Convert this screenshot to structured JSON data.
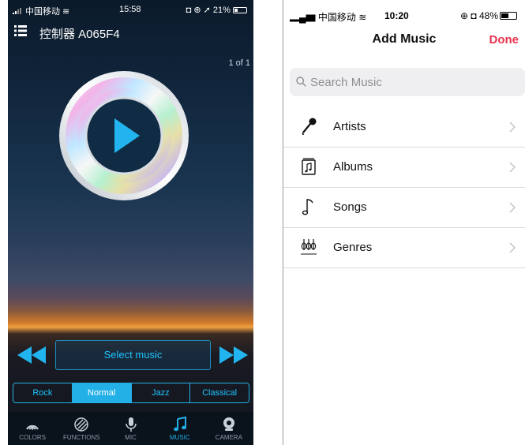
{
  "left_app": {
    "status": {
      "carrier": "中国移动",
      "time": "15:58",
      "battery": "21%"
    },
    "header": {
      "title": "控制器 A065F4"
    },
    "pager": "1 of 1",
    "select_music": "Select music",
    "genres": [
      {
        "label": "Rock",
        "active": false
      },
      {
        "label": "Normal",
        "active": true
      },
      {
        "label": "Jazz",
        "active": false
      },
      {
        "label": "Classical",
        "active": false
      }
    ],
    "tabs": [
      {
        "label": "COLORS",
        "icon": "colors-icon",
        "active": false
      },
      {
        "label": "FUNCTIONS",
        "icon": "functions-icon",
        "active": false
      },
      {
        "label": "MIC",
        "icon": "mic-icon",
        "active": false
      },
      {
        "label": "MUSIC",
        "icon": "music-note-icon",
        "active": true
      },
      {
        "label": "CAMERA",
        "icon": "camera-icon",
        "active": false
      }
    ],
    "accent_color": "#23b0e6"
  },
  "right_app": {
    "status": {
      "carrier": "中国移动",
      "time": "10:20",
      "battery": "48%"
    },
    "nav": {
      "title": "Add Music",
      "done": "Done"
    },
    "search": {
      "placeholder": "Search Music"
    },
    "items": [
      {
        "label": "Artists",
        "icon": "microphone-icon"
      },
      {
        "label": "Albums",
        "icon": "album-icon"
      },
      {
        "label": "Songs",
        "icon": "music-note-icon"
      },
      {
        "label": "Genres",
        "icon": "genres-icon"
      }
    ],
    "accent_color": "#e5334f"
  }
}
